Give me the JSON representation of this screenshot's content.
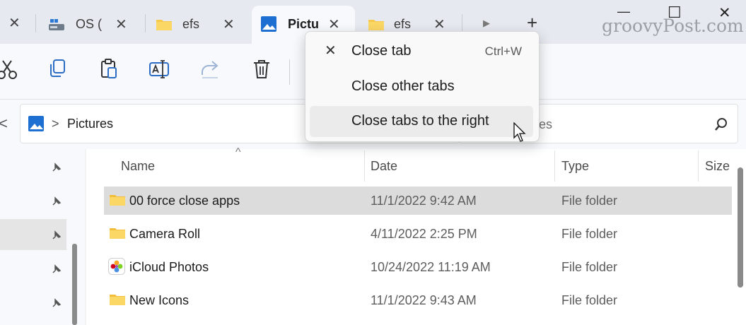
{
  "tabs": [
    {
      "label": "OS (",
      "icon": "drive-icon"
    },
    {
      "label": "efs",
      "icon": "folder-icon"
    },
    {
      "label": "Pictu",
      "icon": "pictures-icon",
      "active": true
    },
    {
      "label": "efs",
      "icon": "folder-icon"
    }
  ],
  "tab_close_glyph": "✕",
  "new_tab_glyph": "+",
  "overflow_glyph": "▶",
  "window_controls": {
    "minimize": "—",
    "maximize": "☐",
    "close": "✕"
  },
  "watermark": "groovyPost.com",
  "toolbar": {
    "icons": [
      "cut-icon",
      "copy-icon",
      "paste-icon",
      "rename-icon",
      "share-icon",
      "delete-icon"
    ]
  },
  "address": {
    "back_glyph": "<",
    "path_sep": ">",
    "location": "Pictures"
  },
  "search": {
    "text": "res"
  },
  "columns": {
    "name": "Name",
    "date": "Date",
    "type": "Type",
    "size": "Size",
    "sort_indicator": "^"
  },
  "files": [
    {
      "name": "00 force close apps",
      "date": "11/1/2022 9:42 AM",
      "type": "File folder",
      "selected": true,
      "icon": "folder-icon"
    },
    {
      "name": "Camera Roll",
      "date": "4/11/2022 2:25 PM",
      "type": "File folder",
      "icon": "folder-icon"
    },
    {
      "name": "iCloud Photos",
      "date": "10/24/2022 11:19 AM",
      "type": "File folder",
      "icon": "photos-icon"
    },
    {
      "name": "New Icons",
      "date": "11/1/2022 9:43 AM",
      "type": "File folder",
      "icon": "folder-icon"
    }
  ],
  "context_menu": {
    "items": [
      {
        "label": "Close tab",
        "shortcut": "Ctrl+W",
        "icon": "close-icon"
      },
      {
        "label": "Close other tabs"
      },
      {
        "label": "Close tabs to the right",
        "hovered": true
      }
    ],
    "close_glyph": "✕"
  },
  "colors": {
    "folder": "#f8c84a",
    "accent": "#0067c0",
    "selected_row": "#dcdcdc"
  }
}
